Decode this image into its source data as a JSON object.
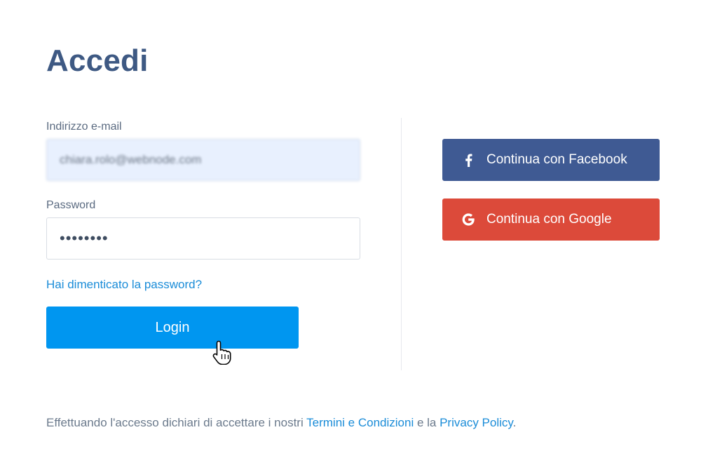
{
  "page": {
    "title": "Accedi"
  },
  "form": {
    "email_label": "Indirizzo e-mail",
    "email_value": "chiara.rolo@webnode.com",
    "password_label": "Password",
    "password_value": "••••••••",
    "forgot_link": "Hai dimenticato la password?",
    "login_label": "Login"
  },
  "social": {
    "facebook_label": "Continua con Facebook",
    "google_label": "Continua con Google"
  },
  "footer": {
    "text_before": "Effettuando l'accesso dichiari di accettare i nostri ",
    "terms_link": "Termini e Condizioni",
    "text_middle": " e la ",
    "privacy_link": "Privacy Policy",
    "text_after": "."
  },
  "colors": {
    "title": "#3e5983",
    "primary": "#0096f0",
    "facebook": "#3f5a93",
    "google": "#dc4a3a",
    "link": "#1a8cd8"
  },
  "icons": {
    "facebook": "facebook-icon",
    "google": "google-icon",
    "cursor": "hand-pointer-icon"
  }
}
